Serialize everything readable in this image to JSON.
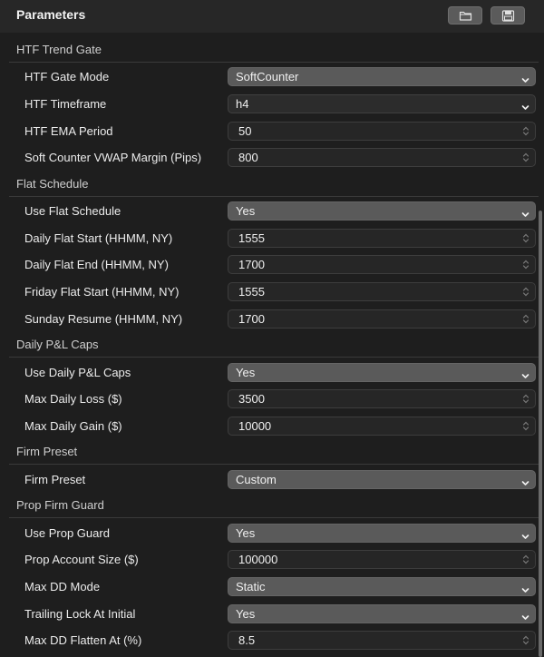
{
  "header": {
    "title": "Parameters",
    "buttons": [
      {
        "icon": "folder-icon"
      },
      {
        "icon": "save-icon"
      }
    ]
  },
  "sections": [
    {
      "label": "HTF Trend Gate",
      "rows": [
        {
          "label": "HTF Gate Mode",
          "type": "select",
          "value": "SoftCounter"
        },
        {
          "label": "HTF Timeframe",
          "type": "select-light",
          "value": "h4"
        },
        {
          "label": "HTF EMA Period",
          "type": "number",
          "value": "50"
        },
        {
          "label": "Soft Counter VWAP Margin (Pips)",
          "type": "number",
          "value": "800"
        }
      ]
    },
    {
      "label": "Flat Schedule",
      "rows": [
        {
          "label": "Use Flat Schedule",
          "type": "select",
          "value": "Yes"
        },
        {
          "label": "Daily Flat Start (HHMM, NY)",
          "type": "number",
          "value": "1555"
        },
        {
          "label": "Daily Flat End (HHMM, NY)",
          "type": "number",
          "value": "1700"
        },
        {
          "label": "Friday Flat Start (HHMM, NY)",
          "type": "number",
          "value": "1555"
        },
        {
          "label": "Sunday Resume (HHMM, NY)",
          "type": "number",
          "value": "1700"
        }
      ]
    },
    {
      "label": "Daily P&L Caps",
      "rows": [
        {
          "label": "Use Daily P&L Caps",
          "type": "select",
          "value": "Yes"
        },
        {
          "label": "Max Daily Loss ($)",
          "type": "number",
          "value": "3500"
        },
        {
          "label": "Max Daily Gain ($)",
          "type": "number",
          "value": "10000"
        }
      ]
    },
    {
      "label": "Firm Preset",
      "rows": [
        {
          "label": "Firm Preset",
          "type": "select",
          "value": "Custom"
        }
      ]
    },
    {
      "label": "Prop Firm Guard",
      "rows": [
        {
          "label": "Use Prop Guard",
          "type": "select",
          "value": "Yes"
        },
        {
          "label": "Prop Account Size ($)",
          "type": "number",
          "value": "100000"
        },
        {
          "label": "Max DD Mode",
          "type": "select",
          "value": "Static"
        },
        {
          "label": "Trailing Lock At Initial",
          "type": "select",
          "value": "Yes"
        },
        {
          "label": "Max DD Flatten At (%)",
          "type": "number",
          "value": "8.5"
        }
      ]
    }
  ]
}
